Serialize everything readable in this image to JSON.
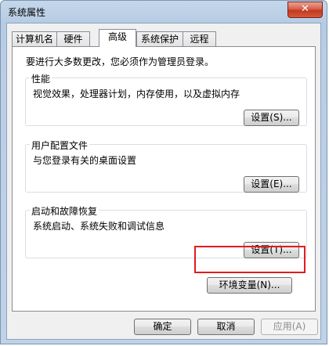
{
  "window": {
    "title": "系统属性",
    "close_symbol": "✕"
  },
  "tabs": [
    {
      "label": "计算机名",
      "active": false
    },
    {
      "label": "硬件",
      "active": false
    },
    {
      "label": "高级",
      "active": true
    },
    {
      "label": "系统保护",
      "active": false
    },
    {
      "label": "远程",
      "active": false
    }
  ],
  "intro": "要进行大多数更改，您必须作为管理员登录。",
  "groups": {
    "performance": {
      "title": "性能",
      "desc": "视觉效果，处理器计划，内存使用，以及虚拟内存",
      "button": "设置(S)..."
    },
    "user_profiles": {
      "title": "用户配置文件",
      "desc": "与您登录有关的桌面设置",
      "button": "设置(E)..."
    },
    "startup_recovery": {
      "title": "启动和故障恢复",
      "desc": "系统启动、系统失败和调试信息",
      "button": "设置(T)..."
    }
  },
  "env_button": "环境变量(N)...",
  "footer": {
    "ok": "确定",
    "cancel": "取消",
    "apply": "应用(A)"
  },
  "colors": {
    "highlight": "#e21b1b",
    "close_button": "#c2371f"
  }
}
